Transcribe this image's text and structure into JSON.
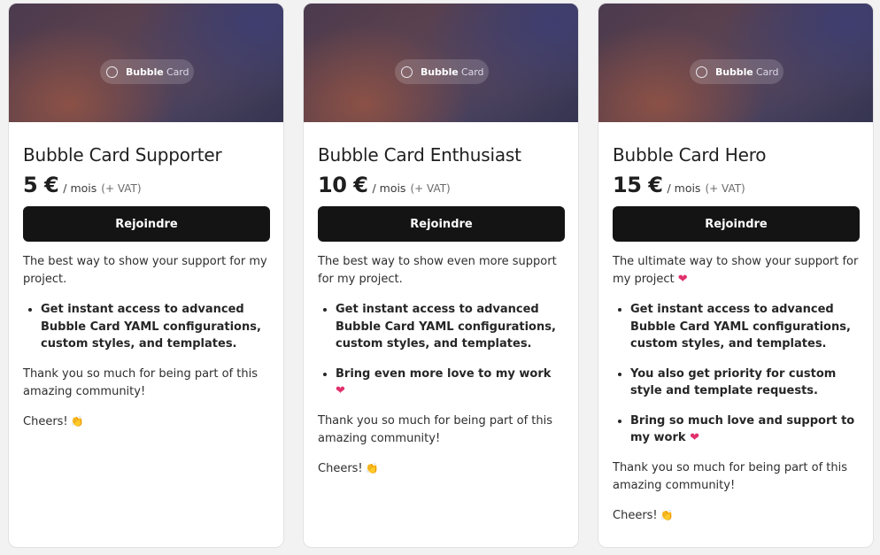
{
  "badge": {
    "text_bold": "Bubble",
    "text_light": "Card"
  },
  "join_label": "Rejoindre",
  "price_period": "/ mois",
  "price_vat": "(+ VAT)",
  "thanks_text": "Thank you so much for being part of this amazing community!",
  "cheers_text": "Cheers!",
  "heart_emoji": "❤",
  "clap_emoji": "👏",
  "cards": [
    {
      "title": "Bubble Card Supporter",
      "price": "5 €",
      "description": "The best way to show your support for my project.",
      "benefits": [
        "Get instant access to advanced Bubble Card YAML configurations, custom styles, and templates."
      ]
    },
    {
      "title": "Bubble Card Enthusiast",
      "price": "10 €",
      "description": "The best way to show even more support for my project.",
      "benefits": [
        "Get instant access to advanced Bubble Card YAML configurations, custom styles, and templates.",
        "Bring even more love to my work"
      ]
    },
    {
      "title": "Bubble Card Hero",
      "price": "15 €",
      "description": "The ultimate way to show your support for my project",
      "benefits": [
        "Get instant access to advanced Bubble Card YAML configurations, custom styles, and templates.",
        "You also get priority for custom style and template requests.",
        "Bring so much love and support to my work"
      ]
    }
  ]
}
